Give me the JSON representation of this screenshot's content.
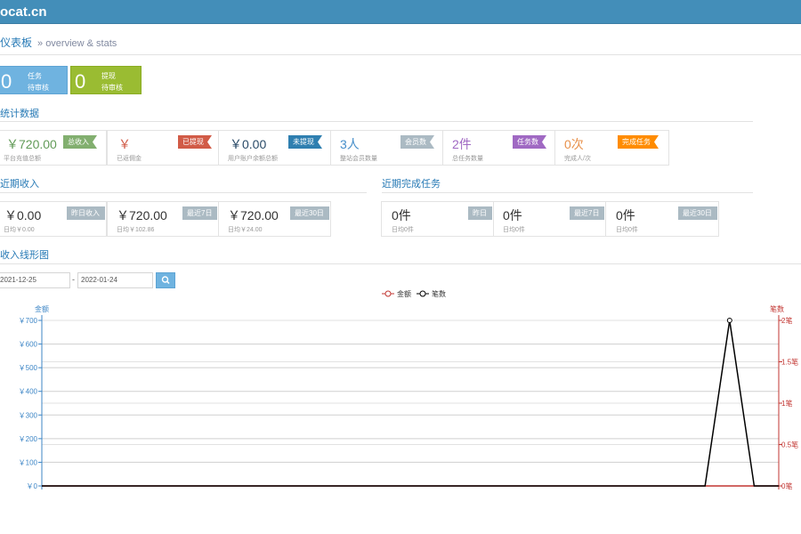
{
  "header": {
    "brand": "ocat.cn"
  },
  "breadcrumb": {
    "title": "仪表板",
    "subtitle": "» overview & stats"
  },
  "tiles": [
    {
      "num": "0",
      "line1": "任务",
      "line2": "待审核",
      "color": "#6fb3e0"
    },
    {
      "num": "0",
      "line1": "提现",
      "line2": "待审核",
      "color": "#9abc32"
    }
  ],
  "sections": {
    "stats": "统计数据",
    "income": "近期收入",
    "tasks": "近期完成任务",
    "chart": "收入线形图"
  },
  "stats": [
    {
      "value": "￥720.00",
      "desc": "平台充值总额",
      "tag": "总收入",
      "color": "#629b58",
      "tag_color": "#82af6f"
    },
    {
      "value": "￥",
      "desc": "已返佣金",
      "tag": "已提现",
      "color": "#d15b47",
      "tag_color": "#d15b47"
    },
    {
      "value": "￥0.00",
      "desc": "用户账户余额总额",
      "tag": "未提现",
      "color": "#2a4b68",
      "tag_color": "#2f7fb0"
    },
    {
      "value": "3人",
      "desc": "整站会员数量",
      "tag": "会员数",
      "color": "#478fca",
      "tag_color": "#abbac3"
    },
    {
      "value": "2件",
      "desc": "总任务数量",
      "tag": "任务数",
      "color": "#a069c3",
      "tag_color": "#a069c3"
    },
    {
      "value": "0次",
      "desc": "完成人/次",
      "tag": "完成任务",
      "color": "#e8914b",
      "tag_color": "#ff8c00"
    }
  ],
  "income": [
    {
      "value": "￥0.00",
      "tag": "昨日收入",
      "desc": "日均￥0.00"
    },
    {
      "value": "￥720.00",
      "tag": "最近7日",
      "desc": "日均￥102.86"
    },
    {
      "value": "￥720.00",
      "tag": "最近30日",
      "desc": "日均￥24.00"
    }
  ],
  "tasks": [
    {
      "value": "0件",
      "tag": "昨日",
      "desc": "日均0件"
    },
    {
      "value": "0件",
      "tag": "最近7日",
      "desc": "日均0件"
    },
    {
      "value": "0件",
      "tag": "最近30日",
      "desc": "日均0件"
    }
  ],
  "date_filter": {
    "start": "2021-12-25",
    "end": "2022-01-24",
    "separator": "-"
  },
  "chart_data": {
    "type": "line",
    "title": "",
    "legend": [
      "金额",
      "笔数"
    ],
    "legend_position": "top-center",
    "ylabel_left": "金额",
    "ylabel_right": "笔数",
    "left_axis_color": "#3d86c6",
    "right_axis_color": "#c23531",
    "left_ticks": [
      "￥0",
      "￥100",
      "￥200",
      "￥300",
      "￥400",
      "￥500",
      "￥600",
      "￥700"
    ],
    "right_ticks": [
      "0笔",
      "0.5笔",
      "1笔",
      "1.5笔",
      "2笔"
    ],
    "ylim_left": [
      0,
      700
    ],
    "ylim_right": [
      0,
      2
    ],
    "grid": true,
    "series": [
      {
        "name": "金额",
        "color": "#c23531",
        "values": [
          0,
          0,
          0,
          0,
          0,
          0,
          0,
          0,
          0,
          0,
          0,
          0,
          0,
          0,
          0,
          0,
          0,
          0,
          0,
          0,
          0,
          0,
          0,
          0,
          0,
          0,
          0,
          0,
          0,
          0,
          0
        ]
      },
      {
        "name": "笔数",
        "color": "#000000",
        "values": [
          0,
          0,
          0,
          0,
          0,
          0,
          0,
          0,
          0,
          0,
          0,
          0,
          0,
          0,
          0,
          0,
          0,
          0,
          0,
          0,
          0,
          0,
          0,
          0,
          0,
          0,
          0,
          0,
          2,
          0,
          0
        ]
      }
    ]
  }
}
